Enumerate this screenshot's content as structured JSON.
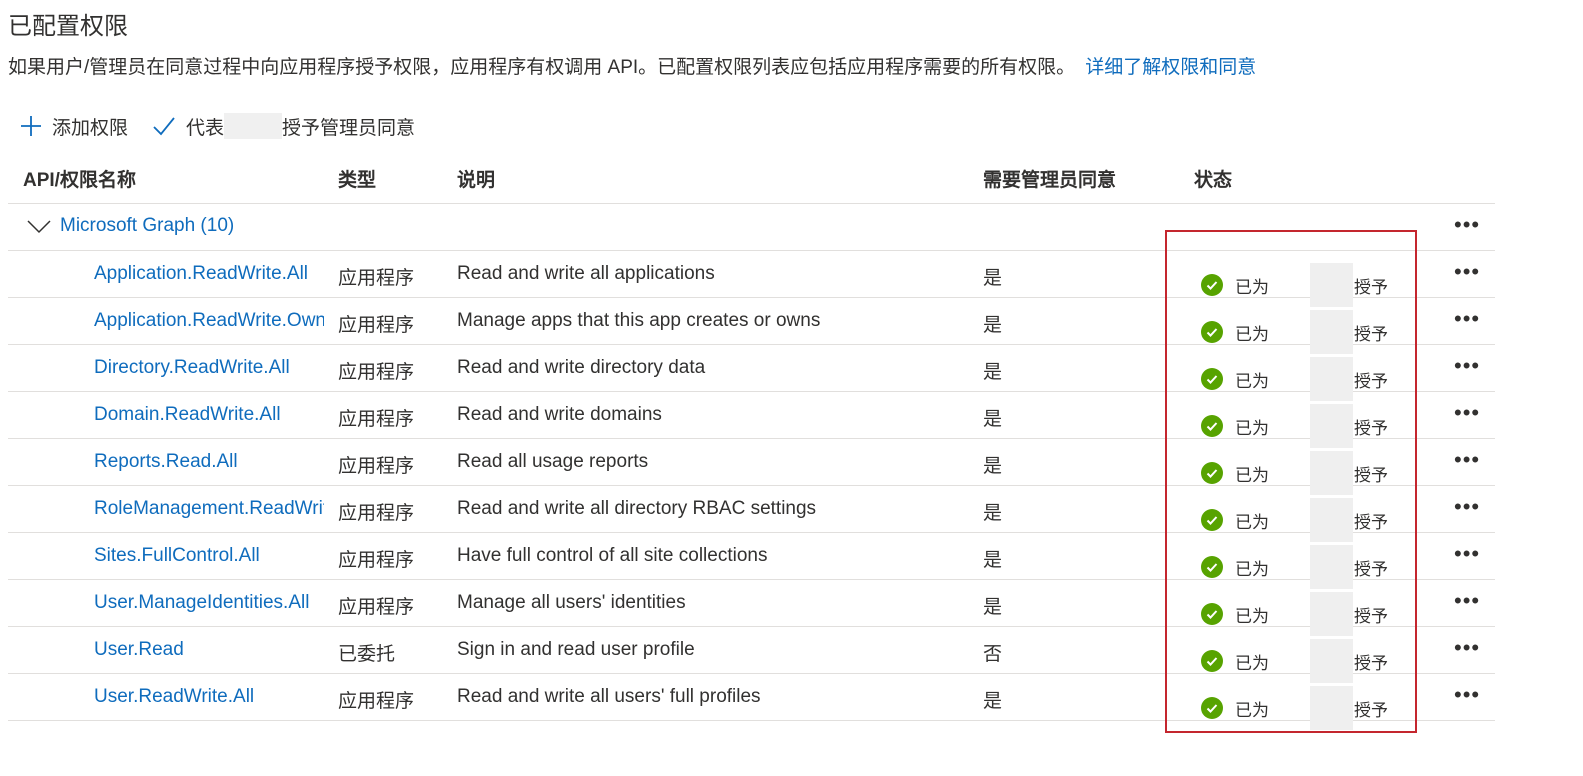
{
  "page_title": "已配置权限",
  "description": "如果用户/管理员在同意过程中向应用程序授予权限，应用程序有权调用 API。已配置权限列表应包括应用程序需要的所有权限。",
  "learn_more_link": "详细了解权限和同意",
  "toolbar": {
    "add_permission_label": "添加权限",
    "grant_consent_prefix": "代表",
    "grant_consent_suffix": "授予管理员同意"
  },
  "columns": {
    "name": "API/权限名称",
    "type": "类型",
    "description": "说明",
    "admin_consent": "需要管理员同意",
    "status": "状态"
  },
  "group": {
    "label": "Microsoft Graph (10)"
  },
  "status_prefix": "已为",
  "status_suffix": "授予",
  "more_label": "•••",
  "permissions": [
    {
      "name": "Application.ReadWrite.All",
      "type": "应用程序",
      "description": "Read and write all applications",
      "admin": "是"
    },
    {
      "name": "Application.ReadWrite.OwnedBy",
      "type": "应用程序",
      "description": "Manage apps that this app creates or owns",
      "admin": "是"
    },
    {
      "name": "Directory.ReadWrite.All",
      "type": "应用程序",
      "description": "Read and write directory data",
      "admin": "是"
    },
    {
      "name": "Domain.ReadWrite.All",
      "type": "应用程序",
      "description": "Read and write domains",
      "admin": "是"
    },
    {
      "name": "Reports.Read.All",
      "type": "应用程序",
      "description": "Read all usage reports",
      "admin": "是"
    },
    {
      "name": "RoleManagement.ReadWrite.Directory",
      "type": "应用程序",
      "description": "Read and write all directory RBAC settings",
      "admin": "是"
    },
    {
      "name": "Sites.FullControl.All",
      "type": "应用程序",
      "description": "Have full control of all site collections",
      "admin": "是"
    },
    {
      "name": "User.ManageIdentities.All",
      "type": "应用程序",
      "description": "Manage all users' identities",
      "admin": "是"
    },
    {
      "name": "User.Read",
      "type": "已委托",
      "description": "Sign in and read user profile",
      "admin": "否"
    },
    {
      "name": "User.ReadWrite.All",
      "type": "应用程序",
      "description": "Read and write all users' full profiles",
      "admin": "是"
    }
  ],
  "colors": {
    "link": "#0f6cbd",
    "granted": "#57a300",
    "highlight": "#c4262e"
  }
}
